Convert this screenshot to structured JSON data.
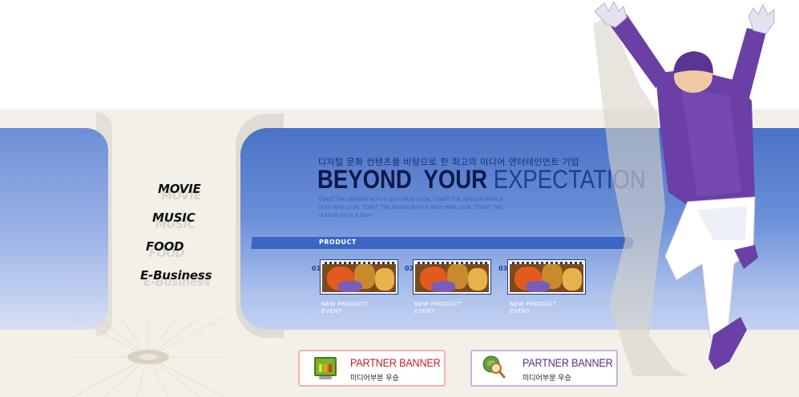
{
  "nav": {
    "items": [
      {
        "label": "MOVIE"
      },
      {
        "label": "MUSIC"
      },
      {
        "label": "FOOD"
      },
      {
        "label": "E-Business"
      }
    ]
  },
  "hero": {
    "korean_tagline": "디지털 문화 컨텐츠를 바탕으로 한 최고의 미디어 엔터테인먼트 기업",
    "headline_part1": "BEYOND  YOUR",
    "headline_part2": "EXPECTATION",
    "body_text": "TOAST THE SEASON WITH A SEXY NEW LOOK. TOAST THE SEASON WITH A SEXY NEW LOOK. TOAST THE EASON WITH A SEXY NEW LOOK. TOAST THE SEASON WITH A SEXY"
  },
  "products": {
    "section_label": "PRODUCT",
    "items": [
      {
        "number": "01",
        "line1": "NEW PRODUCT",
        "line2": "EVENT"
      },
      {
        "number": "02",
        "line1": "NEW PRODUCT",
        "line2": "EVENT"
      },
      {
        "number": "03",
        "line1": "NEW PRODUCT",
        "line2": "EVENT"
      }
    ]
  },
  "banners": [
    {
      "title": "PARTNER BANNER",
      "subtitle": "미디어부분 우승",
      "icon": "chart-monitor-icon"
    },
    {
      "title": "PARTNER BANNER",
      "subtitle": "미디어부분 우승",
      "icon": "globe-magnifier-icon"
    }
  ],
  "colors": {
    "panel_blue": "#4a72c6",
    "headline_navy": "#0b1a49",
    "headline_blue": "#1c3f96",
    "accent_purple": "#6a3fa6",
    "banner_red": "#c21d2a",
    "banner_purple": "#5a2a86"
  }
}
